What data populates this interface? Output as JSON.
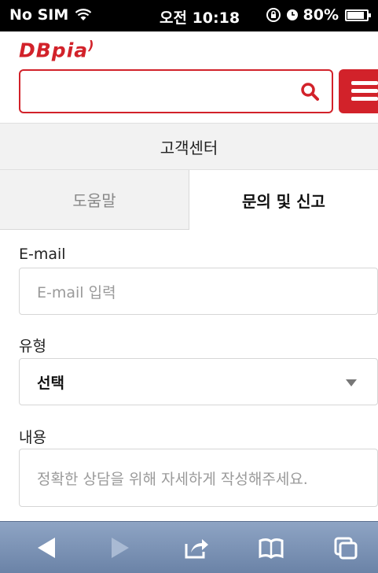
{
  "status_bar": {
    "carrier": "No SIM",
    "time": "오전 10:18",
    "battery": "80%"
  },
  "header": {
    "logo": "DBpia",
    "search": {
      "value": "",
      "placeholder": ""
    }
  },
  "page_title": "고객센터",
  "tabs": [
    {
      "label": "도움말",
      "active": false
    },
    {
      "label": "문의 및 신고",
      "active": true
    }
  ],
  "form": {
    "email": {
      "label": "E-mail",
      "placeholder": "E-mail 입력"
    },
    "type": {
      "label": "유형",
      "selected": "선택"
    },
    "content": {
      "label": "내용",
      "placeholder": "정확한 상담을 위해 자세하게 작성해주세요."
    }
  },
  "toolbar": {
    "icons": [
      "back-icon",
      "forward-icon",
      "share-icon",
      "bookmarks-icon",
      "tabs-icon"
    ]
  },
  "colors": {
    "brand": "#d2222a",
    "toolbar": "#7b92b5"
  }
}
